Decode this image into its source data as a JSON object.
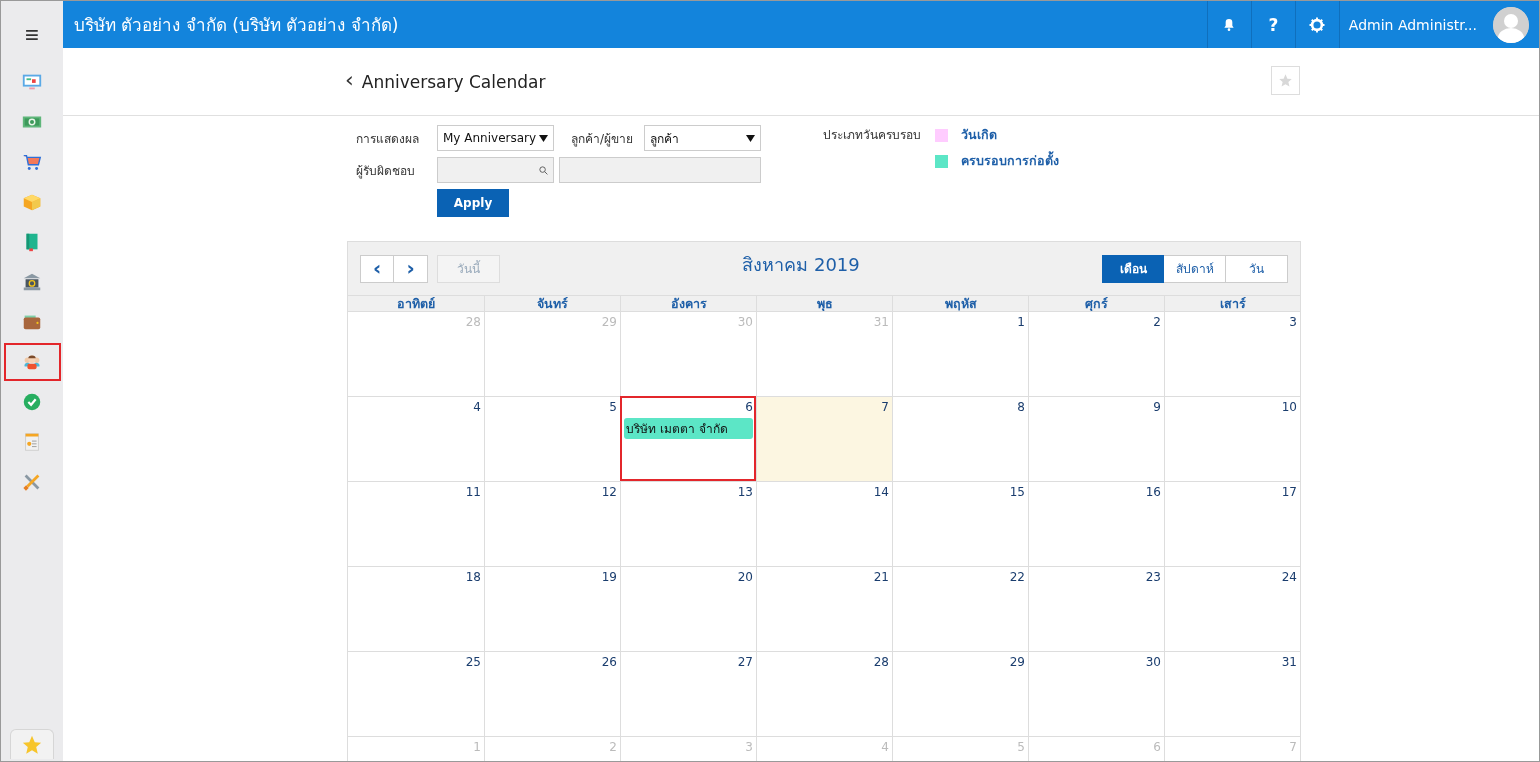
{
  "sidebar": {
    "menu_icon": "≡",
    "items": [
      {
        "kind": "display",
        "selected": false
      },
      {
        "kind": "money",
        "selected": false
      },
      {
        "kind": "cart",
        "selected": false
      },
      {
        "kind": "box",
        "selected": false
      },
      {
        "kind": "book",
        "selected": false
      },
      {
        "kind": "bank",
        "selected": false
      },
      {
        "kind": "wallet",
        "selected": false
      },
      {
        "kind": "people",
        "selected": true
      },
      {
        "kind": "check",
        "selected": false
      },
      {
        "kind": "invoice",
        "selected": false
      },
      {
        "kind": "tools",
        "selected": false
      }
    ]
  },
  "topbar": {
    "title": "บริษัท ตัวอย่าง จำกัด (บริษัท ตัวอย่าง จำกัด)",
    "help": "?",
    "user": "Admin Administr..."
  },
  "page": {
    "back": "‹",
    "title": "Anniversary Calendar"
  },
  "filters": {
    "display": {
      "label": "การแสดงผล",
      "value": "My Anniversary"
    },
    "party": {
      "label": "ลูกค้า/ผู้ขาย",
      "value": "ลูกค้า"
    },
    "owner": {
      "label": "ผู้รับผิดชอบ"
    },
    "apply": "Apply",
    "legend": {
      "label": "ประเภทวันครบรอบ",
      "items": [
        {
          "label": "วันเกิด",
          "color": "#ffccff"
        },
        {
          "label": "ครบรอบการก่อตั้ง",
          "color": "#5ce6c6"
        }
      ]
    }
  },
  "calendar": {
    "prev": "‹",
    "next": "›",
    "today": "วันนี้",
    "title": "สิงหาคม 2019",
    "views": [
      {
        "label": "เดือน",
        "selected": true
      },
      {
        "label": "สัปดาห์",
        "selected": false
      },
      {
        "label": "วัน",
        "selected": false
      }
    ],
    "weekdays": [
      "อาทิตย์",
      "จันทร์",
      "อังคาร",
      "พุธ",
      "พฤหัส",
      "ศุกร์",
      "เสาร์"
    ],
    "weeks": [
      [
        {
          "number": "28",
          "other_month": true,
          "today": false,
          "highlighted": false
        },
        {
          "number": "29",
          "other_month": true,
          "today": false,
          "highlighted": false
        },
        {
          "number": "30",
          "other_month": true,
          "today": false,
          "highlighted": false
        },
        {
          "number": "31",
          "other_month": true,
          "today": false,
          "highlighted": false
        },
        {
          "number": "1",
          "other_month": false,
          "today": false,
          "highlighted": false
        },
        {
          "number": "2",
          "other_month": false,
          "today": false,
          "highlighted": false
        },
        {
          "number": "3",
          "other_month": false,
          "today": false,
          "highlighted": false
        }
      ],
      [
        {
          "number": "4",
          "other_month": false,
          "today": false,
          "highlighted": false
        },
        {
          "number": "5",
          "other_month": false,
          "today": false,
          "highlighted": false
        },
        {
          "number": "6",
          "other_month": false,
          "today": false,
          "highlighted": true,
          "events": [
            {
              "title": "บริษัท เมตตา จำกัด",
              "color": "#5ce6c6"
            }
          ]
        },
        {
          "number": "7",
          "other_month": false,
          "today": true,
          "highlighted": false
        },
        {
          "number": "8",
          "other_month": false,
          "today": false,
          "highlighted": false
        },
        {
          "number": "9",
          "other_month": false,
          "today": false,
          "highlighted": false
        },
        {
          "number": "10",
          "other_month": false,
          "today": false,
          "highlighted": false
        }
      ],
      [
        {
          "number": "11",
          "other_month": false,
          "today": false,
          "highlighted": false
        },
        {
          "number": "12",
          "other_month": false,
          "today": false,
          "highlighted": false
        },
        {
          "number": "13",
          "other_month": false,
          "today": false,
          "highlighted": false
        },
        {
          "number": "14",
          "other_month": false,
          "today": false,
          "highlighted": false
        },
        {
          "number": "15",
          "other_month": false,
          "today": false,
          "highlighted": false
        },
        {
          "number": "16",
          "other_month": false,
          "today": false,
          "highlighted": false
        },
        {
          "number": "17",
          "other_month": false,
          "today": false,
          "highlighted": false
        }
      ],
      [
        {
          "number": "18",
          "other_month": false,
          "today": false,
          "highlighted": false
        },
        {
          "number": "19",
          "other_month": false,
          "today": false,
          "highlighted": false
        },
        {
          "number": "20",
          "other_month": false,
          "today": false,
          "highlighted": false
        },
        {
          "number": "21",
          "other_month": false,
          "today": false,
          "highlighted": false
        },
        {
          "number": "22",
          "other_month": false,
          "today": false,
          "highlighted": false
        },
        {
          "number": "23",
          "other_month": false,
          "today": false,
          "highlighted": false
        },
        {
          "number": "24",
          "other_month": false,
          "today": false,
          "highlighted": false
        }
      ],
      [
        {
          "number": "25",
          "other_month": false,
          "today": false,
          "highlighted": false
        },
        {
          "number": "26",
          "other_month": false,
          "today": false,
          "highlighted": false
        },
        {
          "number": "27",
          "other_month": false,
          "today": false,
          "highlighted": false
        },
        {
          "number": "28",
          "other_month": false,
          "today": false,
          "highlighted": false
        },
        {
          "number": "29",
          "other_month": false,
          "today": false,
          "highlighted": false
        },
        {
          "number": "30",
          "other_month": false,
          "today": false,
          "highlighted": false
        },
        {
          "number": "31",
          "other_month": false,
          "today": false,
          "highlighted": false
        }
      ],
      [
        {
          "number": "1",
          "other_month": true,
          "today": false,
          "highlighted": false
        },
        {
          "number": "2",
          "other_month": true,
          "today": false,
          "highlighted": false
        },
        {
          "number": "3",
          "other_month": true,
          "today": false,
          "highlighted": false
        },
        {
          "number": "4",
          "other_month": true,
          "today": false,
          "highlighted": false
        },
        {
          "number": "5",
          "other_month": true,
          "today": false,
          "highlighted": false
        },
        {
          "number": "6",
          "other_month": true,
          "today": false,
          "highlighted": false
        },
        {
          "number": "7",
          "other_month": true,
          "today": false,
          "highlighted": false
        }
      ]
    ]
  }
}
